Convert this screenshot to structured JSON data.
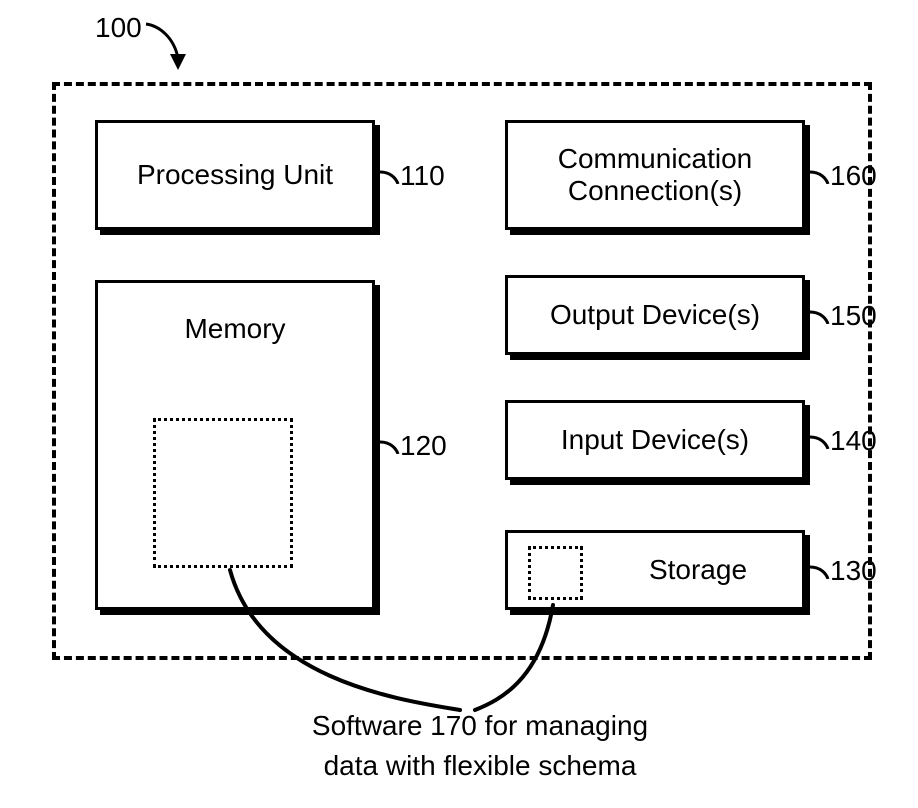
{
  "figure": {
    "label": "100"
  },
  "container": {},
  "components": {
    "processing_unit": {
      "label": "Processing Unit",
      "ref": "110"
    },
    "memory": {
      "label": "Memory",
      "ref": "120"
    },
    "storage": {
      "label": "Storage",
      "ref": "130"
    },
    "input_devices": {
      "label": "Input Device(s)",
      "ref": "140"
    },
    "output_devices": {
      "label": "Output Device(s)",
      "ref": "150"
    },
    "comm_conn": {
      "label": "Communication Connection(s)",
      "ref": "160"
    }
  },
  "caption": {
    "line1": "Software 170 for managing",
    "line2": "data with flexible schema"
  }
}
